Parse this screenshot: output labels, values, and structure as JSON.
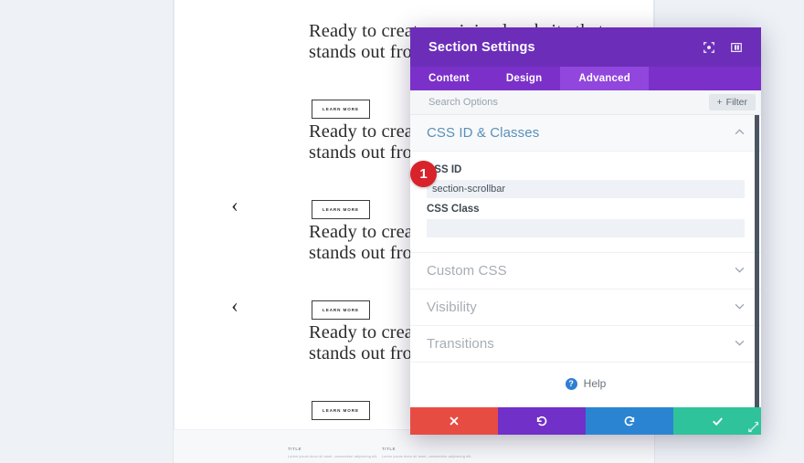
{
  "builder": {
    "hero_headline": "Ready to create a minimal website that stands out from the crowd?",
    "learn_more_label": "LEARN MORE",
    "prev_arrow_icon": "‹",
    "footer_title": "TITLE",
    "footer_text": "Lorem ipsum dolor sit amet, consectetur adipiscing elit."
  },
  "modal": {
    "title": "Section Settings",
    "header_icons": [
      {
        "name": "focus-target-icon"
      },
      {
        "name": "layout-columns-icon"
      }
    ],
    "tabs": [
      {
        "label": "Content",
        "active": false
      },
      {
        "label": "Design",
        "active": false
      },
      {
        "label": "Advanced",
        "active": true
      }
    ],
    "search": {
      "placeholder": "Search Options",
      "value": ""
    },
    "filter_button": {
      "label": "Filter",
      "plus_icon": "+"
    },
    "sections": [
      {
        "title": "CSS ID & Classes",
        "open": true,
        "chevron": "⌃",
        "fields": [
          {
            "label": "CSS ID",
            "value": "section-scrollbar",
            "placeholder": ""
          },
          {
            "label": "CSS Class",
            "value": "",
            "placeholder": ""
          }
        ]
      },
      {
        "title": "Custom CSS",
        "open": false,
        "chevron": "⌄"
      },
      {
        "title": "Visibility",
        "open": false,
        "chevron": "⌄"
      },
      {
        "title": "Transitions",
        "open": false,
        "chevron": "⌄"
      }
    ],
    "help": {
      "label": "Help",
      "icon_char": "?"
    },
    "footer_buttons": [
      {
        "name": "cancel-button",
        "icon": "✖",
        "color": "#e74c43"
      },
      {
        "name": "undo-button",
        "icon": "↺",
        "color": "#7130c8"
      },
      {
        "name": "redo-button",
        "icon": "↻",
        "color": "#2b84d2"
      },
      {
        "name": "save-button",
        "icon": "✔",
        "color": "#2fc39b"
      }
    ]
  },
  "annotation": {
    "step_number": "1"
  }
}
